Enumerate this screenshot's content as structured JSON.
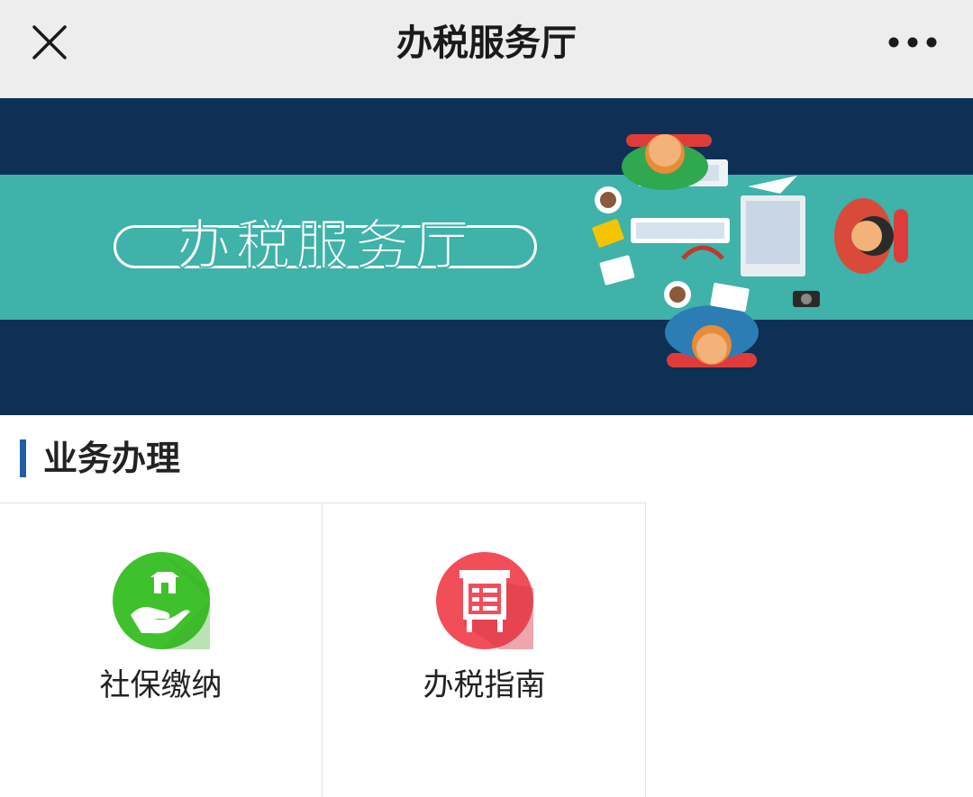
{
  "topbar": {
    "title": "办税服务厅",
    "close_icon": "close-icon",
    "more_icon": "more-dots-icon"
  },
  "banner": {
    "text": "办税服务厅",
    "colors": {
      "dark": "#0e3055",
      "band": "#3fb2a9"
    }
  },
  "section": {
    "title": "业务办理",
    "accent": "#1f5fa6"
  },
  "services": [
    {
      "label": "社保缴纳",
      "icon": "hand-house-icon",
      "color": "#3fc12d"
    },
    {
      "label": "办税指南",
      "icon": "guide-board-icon",
      "color": "#f24e5a"
    }
  ]
}
